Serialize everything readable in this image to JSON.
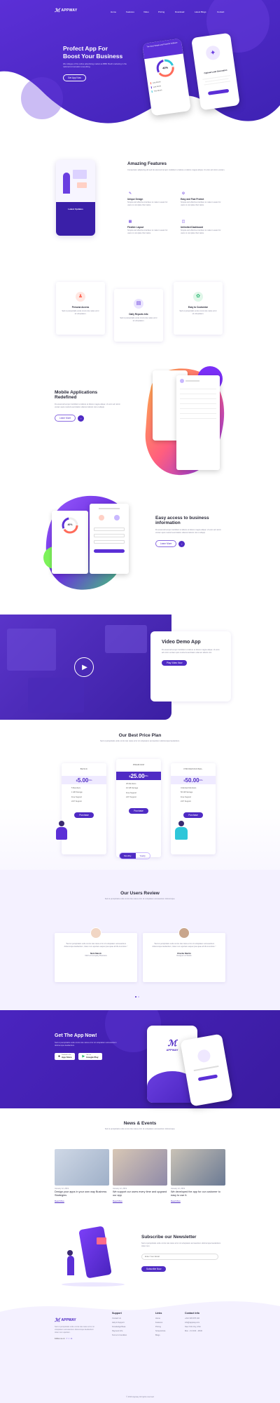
{
  "brand": {
    "name": "APPWAY"
  },
  "nav": {
    "items": [
      "Home",
      "Features",
      "Video",
      "Pricing",
      "Download",
      "Latest Blogs",
      "Contact"
    ]
  },
  "hero": {
    "title_line1": "Profect App For",
    "title_line2": "Boost Your Business",
    "desc": "We collegue of the online advertising market as BBB. Booth marketing in the national conversation everything.",
    "cta": "Get App Now",
    "phone1": {
      "title": "The Most Simple and Powerful Software",
      "percent": "40%",
      "items": [
        "Last Month",
        "Last Week",
        "This Month"
      ]
    },
    "phone2": {
      "title": "Optimal Lead Generation"
    }
  },
  "features": {
    "title": "Amazing Features",
    "intro": "Consectetur adipiscing elit sed do eiusmod tempor incididunt ut labore et dolore magna aliqua. Ut enim ad minim veniam.",
    "phone_caption": "Latest Updates",
    "items": [
      {
        "title": "Unique Design",
        "desc": "Simple and effective interface to make it easier for users to complete their tasks."
      },
      {
        "title": "Easy and Fast Protect",
        "desc": "Simple and effective interface to make it easier for users to complete their tasks."
      },
      {
        "title": "Flexible Layout",
        "desc": "Simple and effective interface to make it easier for users to complete their tasks."
      },
      {
        "title": "Unlimited Dashboard",
        "desc": "Simple and effective interface to make it easier for users to complete their tasks."
      }
    ]
  },
  "mini_features": [
    {
      "title": "Persona Access",
      "desc": "Sed ut perspiciatis unde omnis iste natus error sit voluptatem."
    },
    {
      "title": "Daily Reports Info",
      "desc": "Sed ut perspiciatis unde omnis iste natus error sit voluptatem."
    },
    {
      "title": "Easy to Customize",
      "desc": "Sed ut perspiciatis unde omnis iste natus error sit voluptatem."
    }
  ],
  "mobile_apps": {
    "title_line1": "Mobile Applications",
    "title_line2": "Redefined",
    "desc": "Do eiusmod tempor incididunt ut labore et dolore magna aliqua. Ut enim ad minim veniam quis nostrud exercitation ullamco laboris nisi ut aliquip.",
    "cta": "Learn More"
  },
  "easy_access": {
    "title_line1": "Easy access to business",
    "title_line2": "information",
    "desc": "Do eiusmod tempor incididunt ut labore et dolore magna aliqua. Ut enim ad minim veniam quis nostrud exercitation ullamco laboris nisi ut aliquip.",
    "cta": "Learn More",
    "phone_percent": "40%"
  },
  "video": {
    "title": "Video Demo App",
    "desc": "Do eiusmod tempor incididunt ut labore et dolore magna aliqua. Ut enim ad minim veniam quis nostrud exercitation ullamco laboris nisi.",
    "cta": "Play Video Now"
  },
  "pricing": {
    "title": "Our Best Price Plan",
    "desc": "Sed ut perspiciatis unde omnis iste natus error sit voluptatem accusantium doloremque laudantium.",
    "plans": [
      {
        "name": "BASIC",
        "price": "5.00",
        "unit": "/Mo",
        "features": [
          "5 Members",
          "1 GB Storage",
          "Free Support",
          "24/7 Support"
        ],
        "cta": "Purchase"
      },
      {
        "name": "PREMIUM",
        "price": "25.00",
        "unit": "/Mo",
        "features": [
          "25 Members",
          "10 GB Storage",
          "Free Support",
          "24/7 Support"
        ],
        "cta": "Purchase"
      },
      {
        "name": "PROFESSIONAL",
        "price": "50.00",
        "unit": "/Mo",
        "features": [
          "Unlimited Members",
          "50 GB Storage",
          "Free Support",
          "24/7 Support"
        ],
        "cta": "Purchase"
      }
    ],
    "toggle": {
      "monthly": "Monthly",
      "yearly": "Yearly"
    }
  },
  "reviews": {
    "title": "Our Users Review",
    "desc": "Sed ut perspiciatis unde omnis iste natus error sit voluptatem accusantium doloremque.",
    "items": [
      {
        "quote": "\"Sed ut perspiciatis unde omnis iste natus error sit voluptatem accusantium doloremque laudantium, totam rem aperiam eaque ipsa quae ab illo inventore.\"",
        "name": "Nick Marsh",
        "role": "CEO at Company Business"
      },
      {
        "quote": "\"Sed ut perspiciatis unde omnis iste natus error sit voluptatem accusantium doloremque laudantium, totam rem aperiam eaque ipsa quae ab illo inventore.\"",
        "name": "Charlie Martin",
        "role": "Designer at Studio"
      }
    ]
  },
  "get_app": {
    "title": "Get The App Now!",
    "desc": "Sed ut perspiciatis unde omnis iste natus error sit voluptatem accusantium doloremque laudantium.",
    "app_store_small": "Download on the",
    "app_store": "App Store",
    "google_small": "Get it on",
    "google": "Google Play",
    "phone_brand": "APPWAY"
  },
  "news": {
    "title": "News & Events",
    "desc": "Sed ut perspiciatis unde omnis iste natus error sit voluptatem accusantium doloremque.",
    "items": [
      {
        "date": "January 12, 2019",
        "title": "Design your apps in your own way Business Startegies",
        "link": "Read More"
      },
      {
        "date": "January 12, 2019",
        "title": "We support our users every time and upgrand our app",
        "link": "Read More"
      },
      {
        "date": "January 12, 2019",
        "title": "We developed the app for our customer to easy to use it.",
        "link": "Read More"
      }
    ]
  },
  "newsletter": {
    "title": "Subscribe our Newsletter",
    "desc": "Sed ut perspiciatis unde omnis iste natus error sit voluptatem accusantium doloremque laudantium totam rem.",
    "placeholder": "Enter Your Email",
    "cta": "Subscribe Now"
  },
  "footer": {
    "about": "Sed ut perspiciatis unde omnis iste natus error sit voluptatem accusantium doloremque laudantium totam rem aperiam.",
    "follow": "Follow us on:",
    "support": {
      "title": "Support",
      "items": [
        "Contact Us",
        "Help & Support",
        "Knowledge Base",
        "Payment Info",
        "Terms & Condition"
      ]
    },
    "links": {
      "title": "Links",
      "items": [
        "Home",
        "Features",
        "Pricing",
        "Screenshots",
        "Blogs"
      ]
    },
    "contact": {
      "title": "Contact Info",
      "items": [
        "+012 345 678 102",
        "info@appway.com",
        "New York City, USA",
        "Mon - Fri 9:00 - 18:00"
      ]
    },
    "copyright": "© 2019 Appway All rights reserved"
  }
}
